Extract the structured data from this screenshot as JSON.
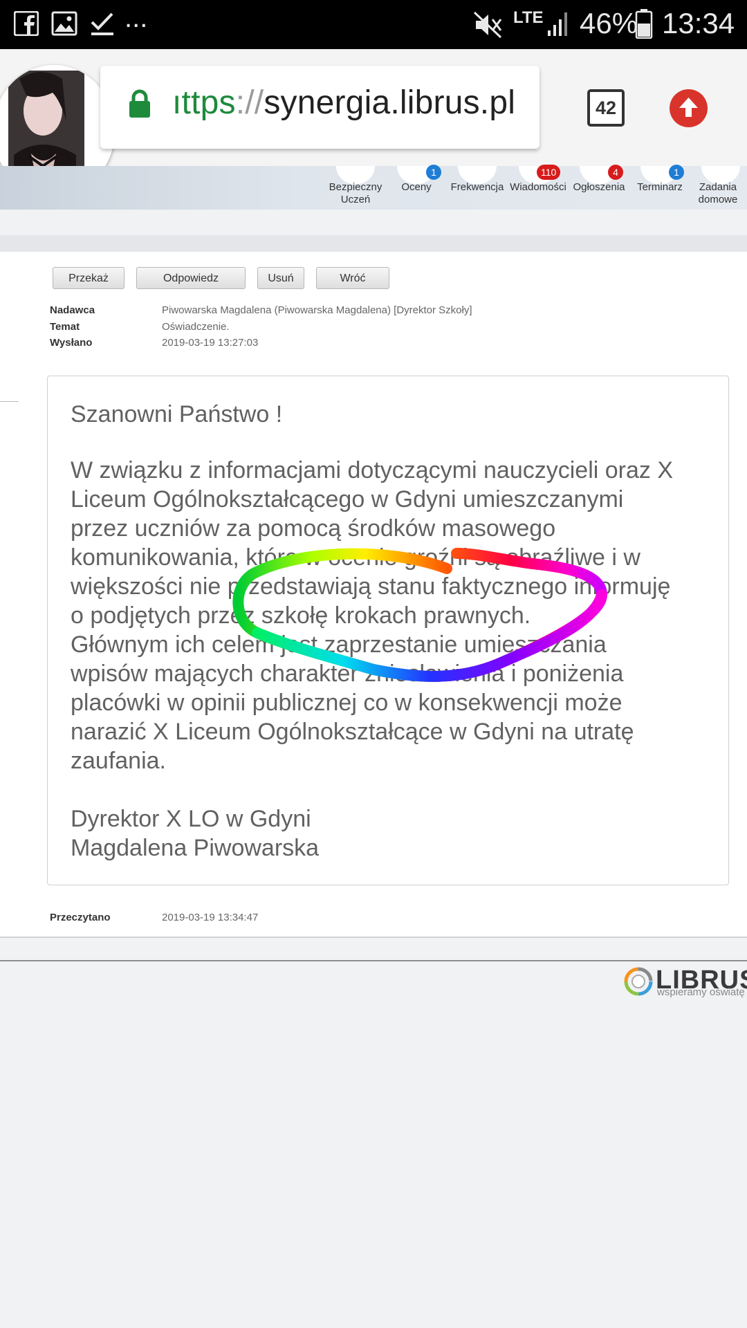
{
  "status_bar": {
    "icons": [
      "facebook-icon",
      "gallery-icon",
      "check-icon",
      "more-icon",
      "mute-icon",
      "lte-icon",
      "signal-icon",
      "battery-icon"
    ],
    "more": "...",
    "network": "LTE",
    "battery": "46%",
    "time": "13:34"
  },
  "browser": {
    "url_scheme": "https",
    "url_scheme_visible": "ıttps",
    "url_slashes": "://",
    "url_host": "synergia.librus.pl",
    "tab_count": "42"
  },
  "nav": {
    "items": [
      {
        "label_1": "Bezpieczny",
        "label_2": "Uczeń",
        "badge": ""
      },
      {
        "label_1": "Oceny",
        "label_2": "",
        "badge": "1"
      },
      {
        "label_1": "Frekwencja",
        "label_2": "",
        "badge": ""
      },
      {
        "label_1": "Wiadomości",
        "label_2": "",
        "badge": "110"
      },
      {
        "label_1": "Ogłoszenia",
        "label_2": "",
        "badge": "4"
      },
      {
        "label_1": "Terminarz",
        "label_2": "",
        "badge": "1"
      },
      {
        "label_1": "Zadania",
        "label_2": "domowe",
        "badge": ""
      }
    ]
  },
  "actions": {
    "forward": "Przekaż",
    "reply": "Odpowiedz",
    "delete": "Usuń",
    "back": "Wróć"
  },
  "message": {
    "sender_label": "Nadawca",
    "sender": "Piwowarska Magdalena (Piwowarska Magdalena) [Dyrektor Szkoły]",
    "subject_label": "Temat",
    "subject": "Oświadczenie.",
    "sent_label": "Wysłano",
    "sent": "2019-03-19 13:27:03",
    "greeting": "Szanowni Państwo !",
    "body_lines": [
      "W związku z informacjami dotyczącymi nauczycieli oraz X",
      "Liceum Ogólnokształcącego w Gdyni umieszczanymi",
      "przez uczniów za pomocą środków masowego",
      "komunikowania, które w ocenie groźni są obraźliwe i w",
      "większości nie przedstawiają stanu faktycznego informuję",
      "o podjętych przez szkołę krokach prawnych.",
      "Głównym ich celem jest zaprzestanie umieszczania",
      "wpisów mających charakter zniesławienia i poniżenia",
      "placówki w opinii publicznej co w konsekwencji może",
      "narazić X Liceum Ogólnokształcące w Gdyni na utratę",
      "zaufania."
    ],
    "signature_1": "Dyrektor X LO w Gdyni",
    "signature_2": "Magdalena Piwowarska",
    "read_label": "Przeczytano",
    "read": "2019-03-19 13:34:47"
  },
  "footer": {
    "brand": "LIBRUS",
    "tagline": "wspieramy oświatę"
  },
  "colors": {
    "accent_red": "#d9342b",
    "badge_blue": "#1f7dd6",
    "badge_red": "#d81b1b",
    "url_green": "#1e8a3c"
  }
}
